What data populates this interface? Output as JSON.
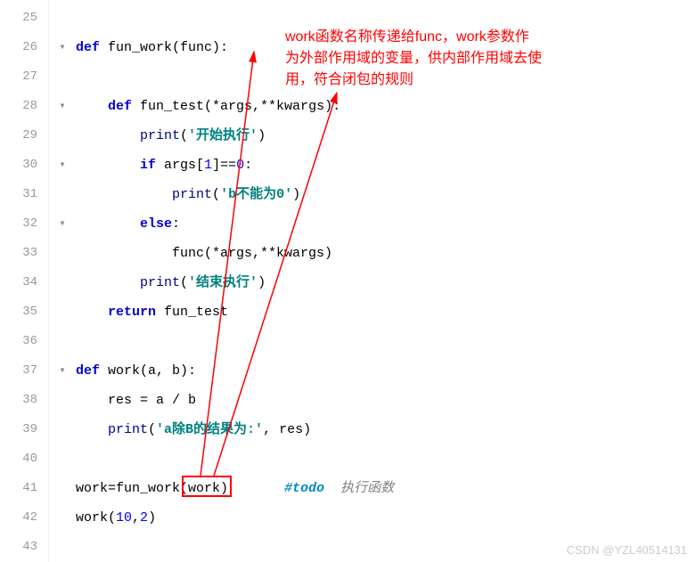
{
  "lines": {
    "start": 25,
    "end": 43
  },
  "fold": {
    "26": "▾",
    "28": "▾",
    "30": "▾",
    "32": "▾",
    "37": "▾"
  },
  "code": {
    "26_def": "def",
    "26_name": " fun_work(func):",
    "28_def": "def",
    "28_name": " fun_test(*args,**kwargs):",
    "29_print": "print",
    "29_str": "'开始执行'",
    "30_if": "if",
    "30_rest1": " args[",
    "30_idx": "1",
    "30_rest2": "]==",
    "30_zero": "0",
    "30_colon": ":",
    "31_print": "print",
    "31_str": "'b不能为0'",
    "32_else": "else",
    "32_colon": ":",
    "33_call": "func(*args,**kwargs)",
    "34_print": "print",
    "34_str": "'结束执行'",
    "35_return": "return",
    "35_val": " fun_test",
    "37_def": "def",
    "37_name": " work(a, b):",
    "38_text": "res = a / b",
    "39_print": "print",
    "39_str": "'a除B的结果为:'",
    "39_rest": ", res)",
    "41_lhs": "work=fun_work(work)",
    "41_todo": "#todo",
    "41_comment": "  执行函数",
    "42_text": "work(",
    "42_n1": "10",
    "42_comma": ",",
    "42_n2": "2",
    "42_close": ")"
  },
  "annotation": {
    "l1": "work函数名称传递给func，work参数作",
    "l2": "为外部作用域的变量，供内部作用域去使",
    "l3": "用，符合闭包的规则"
  },
  "watermark": "CSDN @YZL40514131"
}
